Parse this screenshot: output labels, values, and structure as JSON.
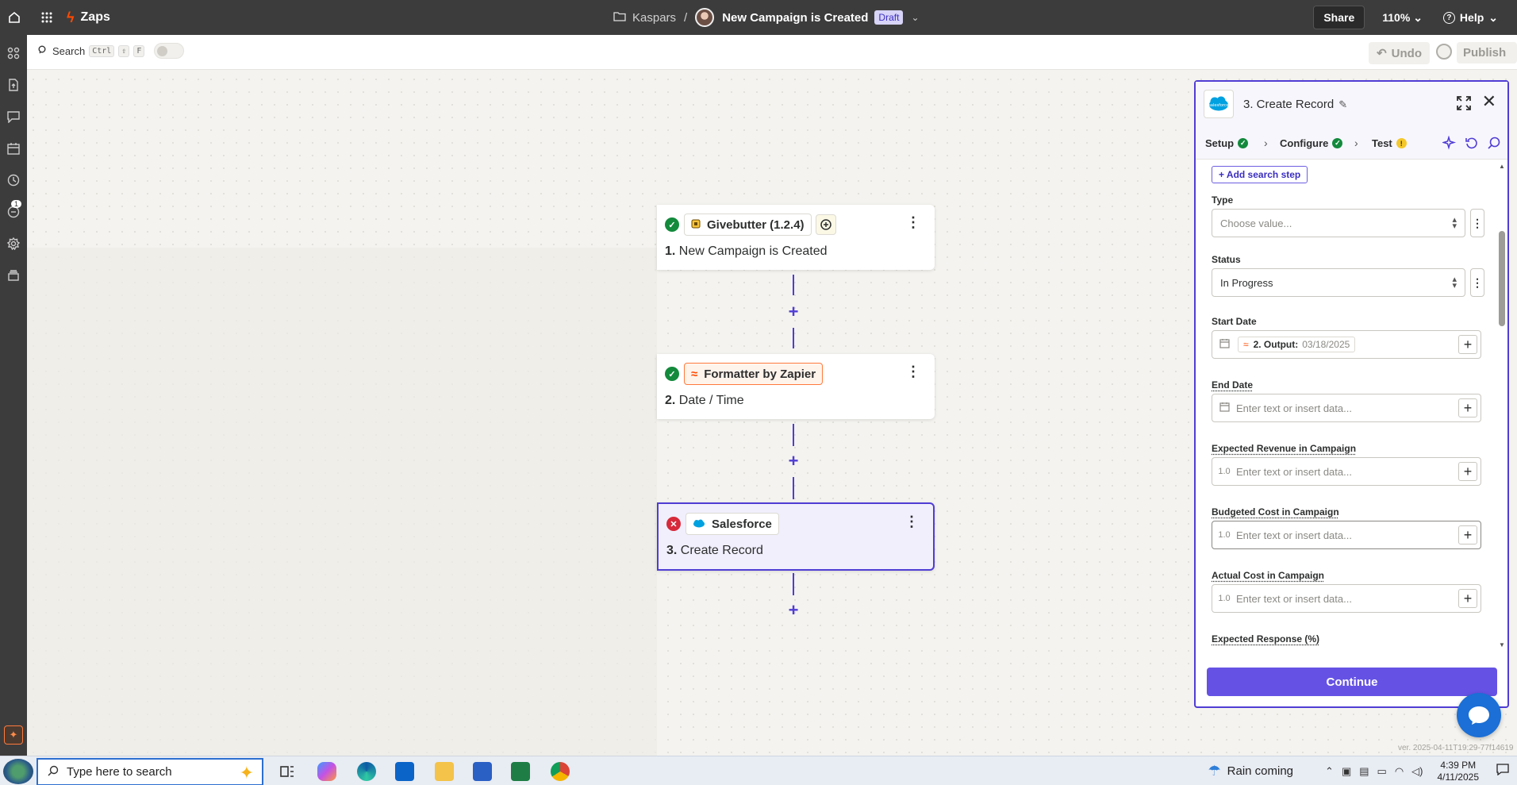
{
  "topbar": {
    "app_name": "Zaps",
    "breadcrumb_folder": "Kaspars",
    "breadcrumb_sep": "/",
    "zap_title": "New Campaign is Created",
    "status_badge": "Draft",
    "share_label": "Share",
    "zoom_label": "110%",
    "help_label": "Help"
  },
  "toolbar": {
    "search_label": "Search",
    "shortcut_keys": [
      "Ctrl",
      "⇧",
      "F"
    ],
    "undo_label": "Undo",
    "publish_label": "Publish"
  },
  "left_rail": {
    "notification_count": "1"
  },
  "steps": [
    {
      "status": "ok",
      "app": "Givebutter (1.2.4)",
      "number": "1.",
      "title": "New Campaign is Created"
    },
    {
      "status": "ok",
      "app": "Formatter by Zapier",
      "number": "2.",
      "title": "Date / Time"
    },
    {
      "status": "error",
      "app": "Salesforce",
      "number": "3.",
      "title": "Create Record"
    }
  ],
  "panel": {
    "title": "3. Create Record",
    "tabs": [
      {
        "label": "Setup",
        "status": "ok"
      },
      {
        "label": "Configure",
        "status": "ok"
      },
      {
        "label": "Test",
        "status": "warning",
        "warn_glyph": "!"
      }
    ],
    "add_search_step": "+ Add search step",
    "fields": {
      "type": {
        "label": "Type",
        "placeholder": "Choose value..."
      },
      "status": {
        "label": "Status",
        "value": "In Progress"
      },
      "start_date": {
        "label": "Start Date",
        "chip_label": "2. Output:",
        "chip_value": "03/18/2025"
      },
      "end_date": {
        "label": "End Date",
        "placeholder": "Enter text or insert data..."
      },
      "expected_revenue": {
        "label": "Expected Revenue in Campaign",
        "placeholder": "Enter text or insert data..."
      },
      "budgeted_cost": {
        "label": "Budgeted Cost in Campaign",
        "placeholder": "Enter text or insert data..."
      },
      "actual_cost": {
        "label": "Actual Cost in Campaign",
        "placeholder": "Enter text or insert data..."
      },
      "expected_response": {
        "label": "Expected Response (%)"
      }
    },
    "number_prefix": "1.0",
    "continue_label": "Continue"
  },
  "version_text": "ver. 2025-04-11T19:29-77f14619",
  "taskbar": {
    "search_placeholder": "Type here to search",
    "weather": "Rain coming",
    "time": "4:39 PM",
    "date": "4/11/2025"
  },
  "colors": {
    "accent": "#503dd4",
    "success": "#138a3c",
    "error": "#d6293a",
    "zapier_orange": "#ff4a00"
  }
}
